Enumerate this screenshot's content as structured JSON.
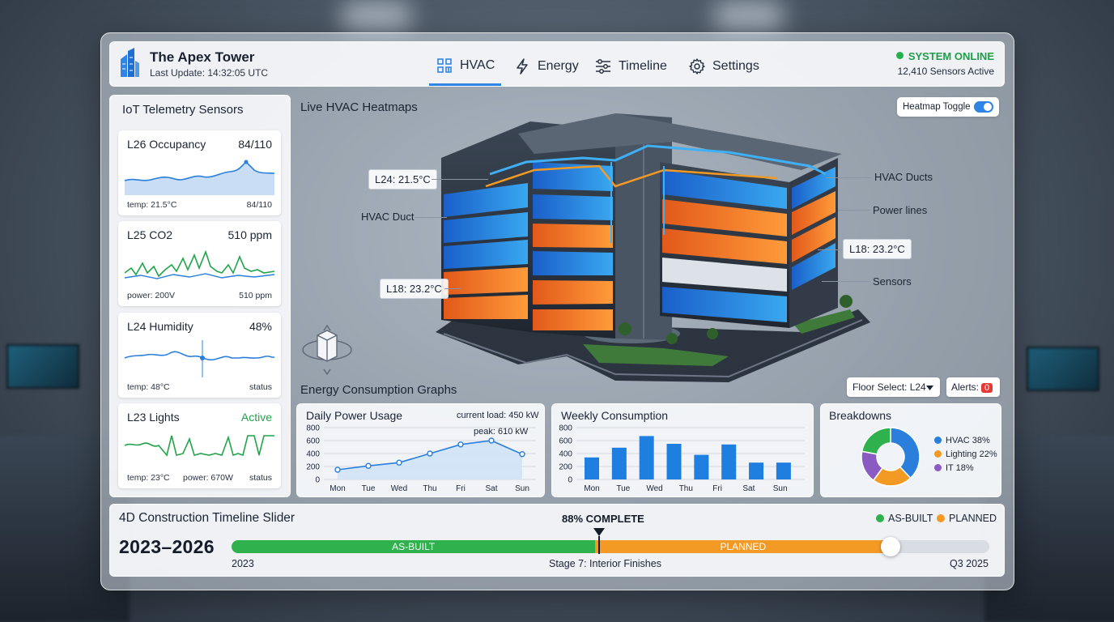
{
  "header": {
    "title": "The Apex Tower",
    "last_update": "Last Update: 14:32:05 UTC",
    "nav": [
      {
        "label": "HVAC",
        "icon": "hvac-icon",
        "active": true
      },
      {
        "label": "Energy",
        "icon": "lightning-icon",
        "active": false
      },
      {
        "label": "Timeline",
        "icon": "sliders-icon",
        "active": false
      },
      {
        "label": "Settings",
        "icon": "gear-icon",
        "active": false
      }
    ],
    "system_status": "SYSTEM ONLINE",
    "sensors_active": "12,410 Sensors Active",
    "status_color": "#22b14c",
    "accent_color": "#2f84e4"
  },
  "sensors": {
    "title": "IoT Telemetry Sensors",
    "cards": [
      {
        "name": "L26 Occupancy",
        "value": "84/110",
        "foot_left": "temp: 21.5°C",
        "foot_right": "84/110"
      },
      {
        "name": "L25 CO2",
        "value": "510 ppm",
        "foot_left": "power: 200V",
        "foot_right": "510 ppm"
      },
      {
        "name": "L24 Humidity",
        "value": "48%",
        "foot_left": "temp: 48°C",
        "foot_right": "status"
      },
      {
        "name": "L23 Lights",
        "value": "Active",
        "foot_left": "temp: 23°C",
        "foot_mid": "power: 670W",
        "foot_right": "status"
      }
    ]
  },
  "heatmap": {
    "title": "Live HVAC Heatmaps",
    "toggle_label": "Heatmap Toggle",
    "toggle_on": true,
    "callouts": [
      "L24: 21.5°C",
      "L18: 23.2°C",
      "L18: 23.2°C"
    ],
    "labels": [
      "HVAC Duct",
      "HVAC Ducts",
      "Power lines",
      "Sensors"
    ]
  },
  "energy": {
    "title": "Energy Consumption Graphs",
    "floor_select": "Floor Select: L24",
    "alerts_label": "Alerts:",
    "alerts_count": "0"
  },
  "daily": {
    "title": "Daily Power Usage",
    "current_load": "current load: 450 kW",
    "peak": "peak: 610 kW"
  },
  "weekly": {
    "title": "Weekly Consumption"
  },
  "breakdowns": {
    "title": "Breakdowns"
  },
  "chart_data": [
    {
      "type": "line",
      "title": "Daily Power Usage",
      "categories": [
        "Mon",
        "Tue",
        "Wed",
        "Thu",
        "Fri",
        "Sat",
        "Sun"
      ],
      "values": [
        150,
        210,
        260,
        400,
        540,
        600,
        390
      ],
      "ylim": [
        0,
        800
      ],
      "yticks": [
        0,
        200,
        400,
        600,
        800
      ],
      "grid": true
    },
    {
      "type": "bar",
      "title": "Weekly Consumption",
      "categories": [
        "Mon",
        "Tue",
        "Wed",
        "Thu",
        "Fri",
        "Sat",
        "Sun"
      ],
      "values": [
        340,
        490,
        670,
        550,
        380,
        540,
        260,
        260
      ],
      "ylim": [
        0,
        800
      ],
      "yticks": [
        0,
        200,
        400,
        600,
        800
      ],
      "grid": true
    },
    {
      "type": "pie",
      "title": "Breakdowns",
      "slices": [
        {
          "name": "HVAC 38%",
          "value": 38,
          "color": "#2a7fdc"
        },
        {
          "name": "Lighting 22%",
          "value": 22,
          "color": "#f39a25"
        },
        {
          "name": "IT 18%",
          "value": 18,
          "color": "#8a5bc2"
        },
        {
          "name": "",
          "value": 22,
          "color": "#2fb24e"
        }
      ],
      "legend": "right"
    }
  ],
  "timeline": {
    "title": "4D Construction Timeline Slider",
    "years": "2023–2026",
    "percent_label": "88% COMPLETE",
    "legend_asbuilt": "AS-BUILT",
    "legend_planned": "PLANNED",
    "bar_asbuilt": "AS-BUILT",
    "bar_planned": "PLANNED",
    "as_built_fraction": 0.48,
    "planned_end_fraction": 0.87,
    "start_label": "2023",
    "stage": "Stage 7: Interior Finishes",
    "end_label": "Q3 2025",
    "color_asbuilt": "#2fb24e",
    "color_planned": "#f39a25"
  }
}
